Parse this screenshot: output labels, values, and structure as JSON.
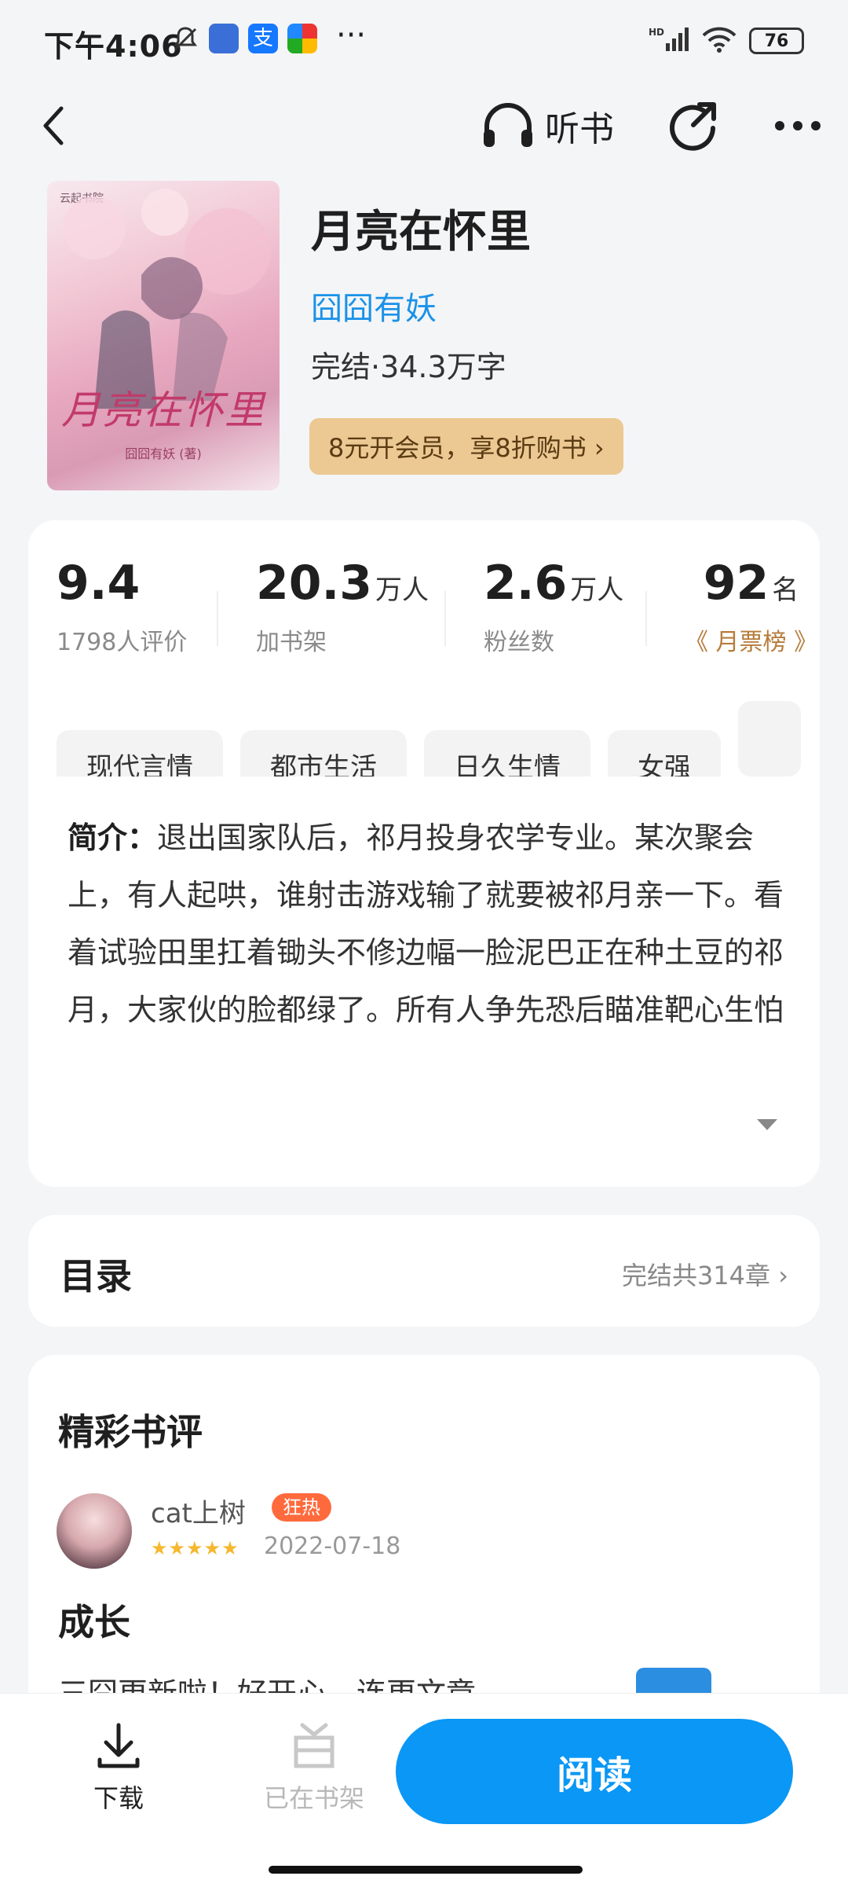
{
  "status_bar": {
    "time": "下午4:06",
    "dots": "···",
    "battery": "76",
    "network": "HD"
  },
  "header": {
    "listen_label": "听书"
  },
  "book": {
    "cover_title": "月亮在怀里",
    "cover_author": "囧囧有妖 (著)",
    "cover_publisher": "云起书院",
    "title": "月亮在怀里",
    "author": "囧囧有妖",
    "meta": "完结·34.3万字",
    "vip_promo": "8元开会员，享8折购书 ›"
  },
  "stats": [
    {
      "value": "9.4",
      "unit": "",
      "label": "1798人评价"
    },
    {
      "value": "20.3",
      "unit": "万人",
      "label": "加书架"
    },
    {
      "value": "2.6",
      "unit": "万人",
      "label": "粉丝数"
    },
    {
      "value": "92",
      "unit": "名",
      "label": "《 月票榜 》"
    }
  ],
  "tags": [
    "现代言情",
    "都市生活",
    "日久生情",
    "女强"
  ],
  "intro": {
    "prefix": "简介：",
    "text": "退出国家队后，祁月投身农学专业。某次聚会上，有人起哄，谁射击游戏输了就要被祁月亲一下。看着试验田里扛着锄头不修边幅一脸泥巴正在种土豆的祁月，大家伙的脸都绿了。所有人争先恐后瞄准靶心生怕被罚。最后的结果是，A大男神顾淮抬起手，脱靶射了一个0环。第二..."
  },
  "toc": {
    "title": "目录",
    "info": "完结共314章 ›"
  },
  "reviews": {
    "title": "精彩书评",
    "item": {
      "user": "cat上树",
      "badge": "狂热",
      "stars": "★★★★★",
      "date": "2022-07-18",
      "headline": "成长",
      "body": "三囧更新啦！好开心，连更文章"
    }
  },
  "bottom_bar": {
    "download": "下载",
    "shelf": "已在书架",
    "read": "阅读"
  },
  "colors": {
    "accent": "#0a97f5",
    "author_link": "#1a92e8",
    "vip_bg": "#ecc893",
    "hot_badge": "#ff6a3d"
  }
}
